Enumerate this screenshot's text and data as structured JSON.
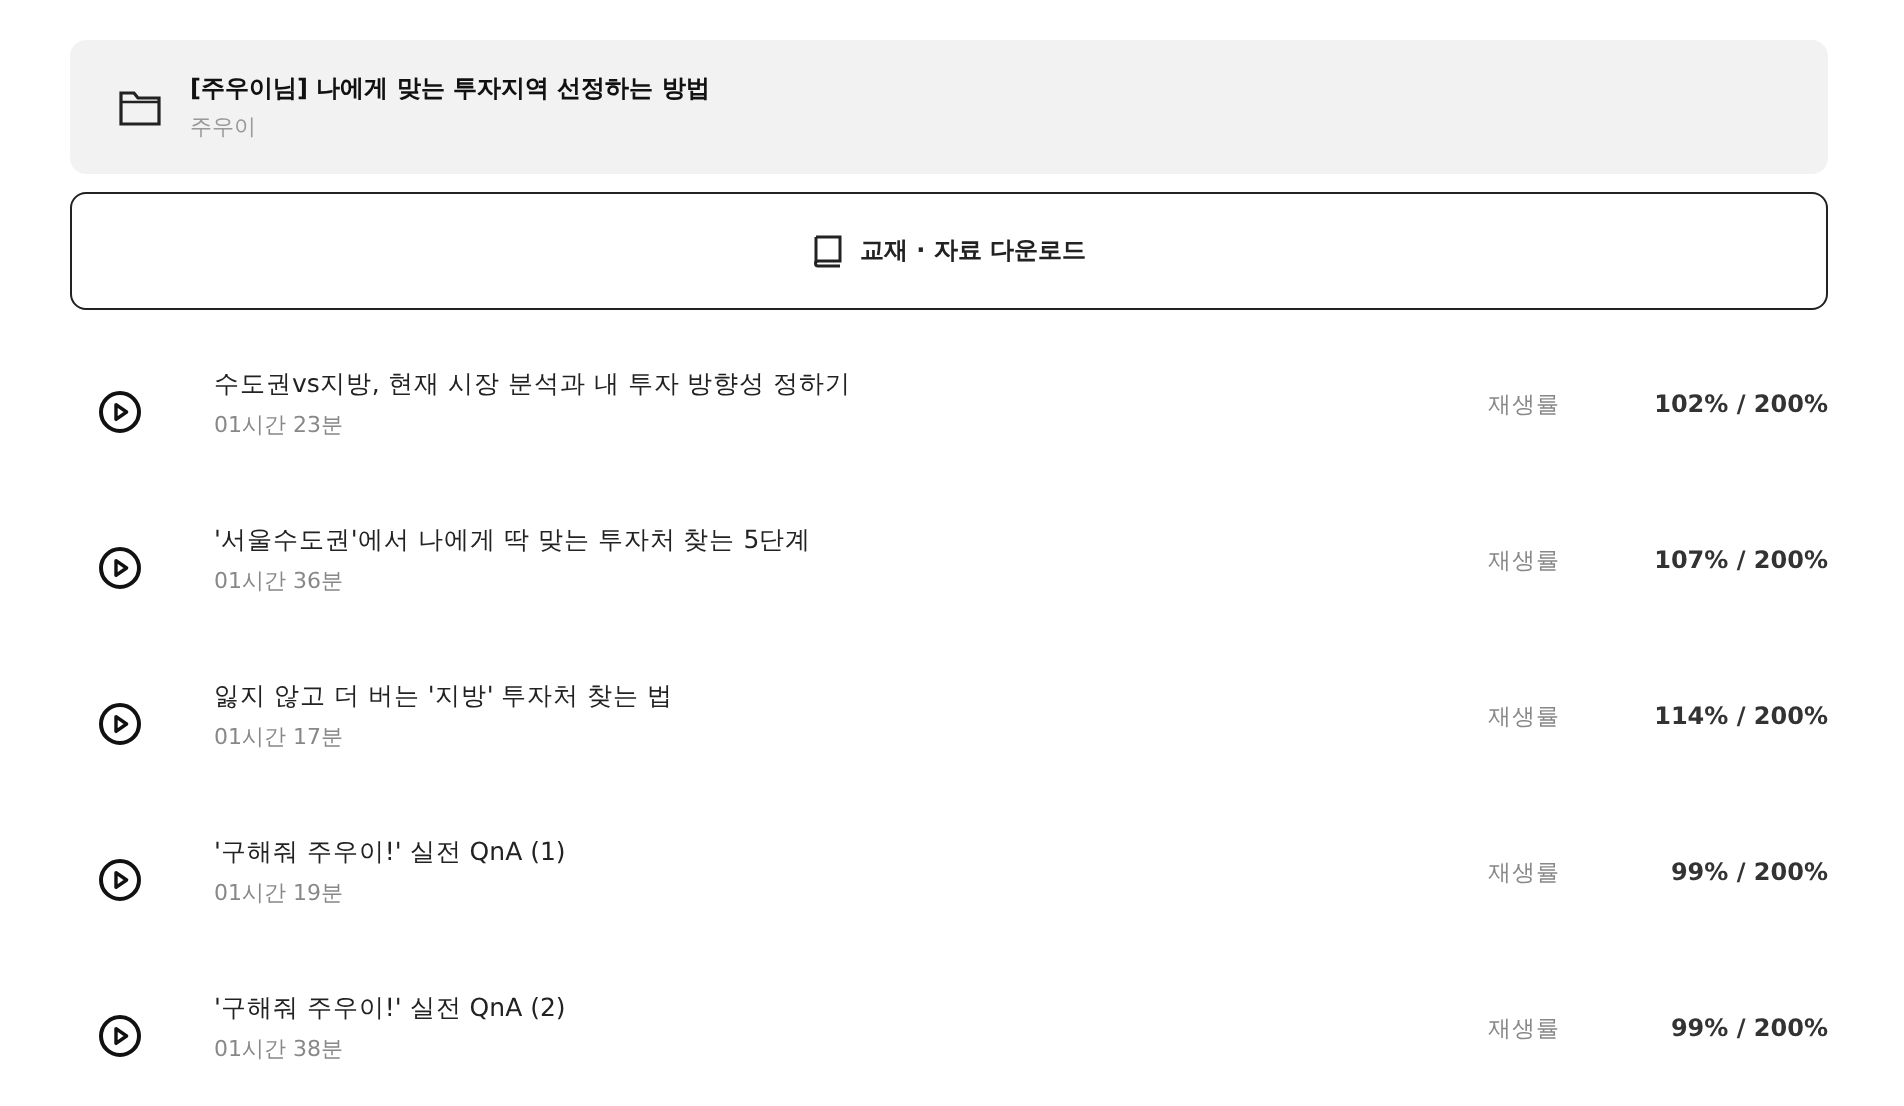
{
  "course": {
    "title": "[주우이님] 나에게 맞는 투자지역 선정하는 방법",
    "author": "주우이"
  },
  "download_button": {
    "label": "교재 · 자료 다운로드"
  },
  "lessons": [
    {
      "title": "수도권vs지방, 현재 시장 분석과 내 투자 방향성 정하기",
      "duration": "01시간 23분",
      "rate_label": "재생률",
      "rate": "102% / 200%"
    },
    {
      "title": "'서울수도권'에서 나에게 딱 맞는 투자처 찾는 5단계",
      "duration": "01시간 36분",
      "rate_label": "재생률",
      "rate": "107% / 200%"
    },
    {
      "title": "잃지 않고 더 버는 '지방' 투자처 찾는 법",
      "duration": "01시간 17분",
      "rate_label": "재생률",
      "rate": "114% / 200%"
    },
    {
      "title": "'구해줘 주우이!' 실전 QnA (1)",
      "duration": "01시간 19분",
      "rate_label": "재생률",
      "rate": "99% / 200%"
    },
    {
      "title": "'구해줘 주우이!' 실전 QnA (2)",
      "duration": "01시간 38분",
      "rate_label": "재생률",
      "rate": "99% / 200%"
    }
  ]
}
